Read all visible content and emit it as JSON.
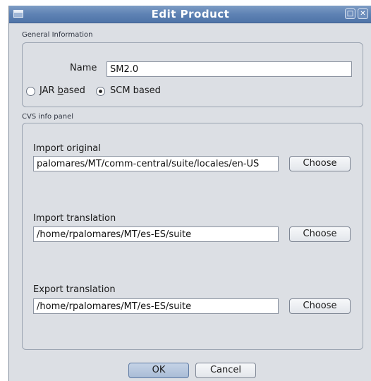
{
  "window": {
    "title": "Edit Product"
  },
  "general": {
    "group_label": "General Information",
    "name_label": "Name",
    "name_value": "SM2.0",
    "radio_jar_pre": "JAR ",
    "radio_jar_ul": "b",
    "radio_jar_post": "ased",
    "radio_scm": "SCM based",
    "selected": "SCM based"
  },
  "cvs": {
    "group_label": "CVS info panel",
    "rows": [
      {
        "label": "Import original",
        "value": "palomares/MT/comm-central/suite/locales/en-US",
        "button": "Choose"
      },
      {
        "label": "Import translation",
        "value": "/home/rpalomares/MT/es-ES/suite",
        "button": "Choose"
      },
      {
        "label": "Export translation",
        "value": "/home/rpalomares/MT/es-ES/suite",
        "button": "Choose"
      }
    ]
  },
  "footer": {
    "ok_label": "OK",
    "cancel_label": "Cancel"
  },
  "icons": [
    "window-menu-icon",
    "maximize-icon",
    "close-icon"
  ]
}
